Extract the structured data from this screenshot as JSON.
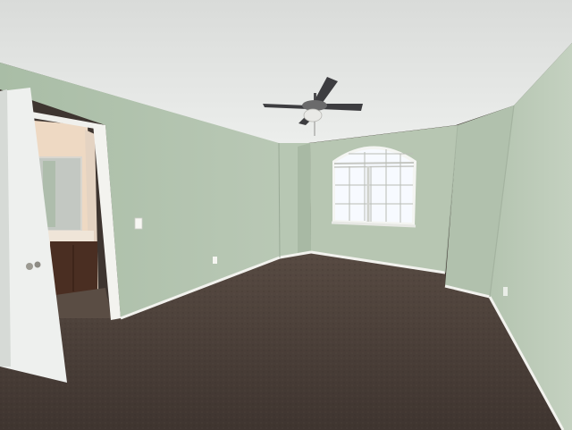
{
  "image": {
    "subject": "empty-bedroom",
    "colors": {
      "ceiling": "#e2e3e2",
      "wall_left": "#adc1aa",
      "wall_back": "#b5c4b0",
      "wall_right": "#bccbb8",
      "carpet": "#4b4038",
      "trim": "#f2f2ee",
      "door": "#eef0ee",
      "bath_wall": "#eed8c1",
      "vanity": "#4a2e22",
      "window_glass": "#f7faff",
      "fan_blade": "#3d3d40"
    }
  }
}
